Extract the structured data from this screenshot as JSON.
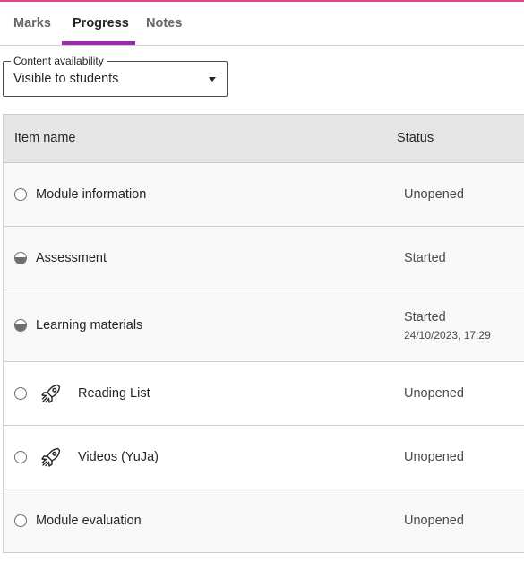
{
  "tabs": [
    {
      "label": "Marks",
      "active": false
    },
    {
      "label": "Progress",
      "active": true
    },
    {
      "label": "Notes",
      "active": false
    }
  ],
  "content_availability": {
    "label": "Content availability",
    "value": "Visible to students"
  },
  "table": {
    "headers": {
      "item_name": "Item name",
      "status": "Status"
    },
    "rows": [
      {
        "name": "Module information",
        "status": "Unopened",
        "progress": "none",
        "icon": ""
      },
      {
        "name": "Assessment",
        "status": "Started",
        "progress": "half",
        "icon": ""
      },
      {
        "name": "Learning materials",
        "status": "Started",
        "date": "24/10/2023, 17:29",
        "progress": "half",
        "icon": ""
      },
      {
        "name": "Reading List",
        "status": "Unopened",
        "progress": "none",
        "icon": "rocket-icon"
      },
      {
        "name": "Videos (YuJa)",
        "status": "Unopened",
        "progress": "none",
        "icon": "rocket-icon"
      },
      {
        "name": "Module evaluation",
        "status": "Unopened",
        "progress": "none",
        "icon": ""
      }
    ]
  },
  "colors": {
    "accent_underline": "#9c27b0",
    "top_line": "#e0468a"
  }
}
